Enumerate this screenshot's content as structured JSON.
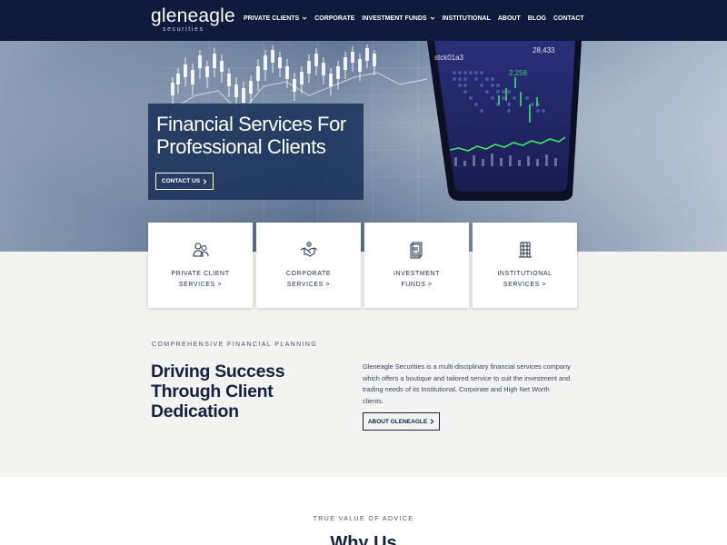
{
  "brand": {
    "name": "gleneagle",
    "tagline": "securities"
  },
  "nav": {
    "items": [
      {
        "label": "Private Clients",
        "dropdown": true
      },
      {
        "label": "Corporate",
        "dropdown": false
      },
      {
        "label": "Investment Funds",
        "dropdown": true
      },
      {
        "label": "Institutional",
        "dropdown": false
      },
      {
        "label": "About",
        "dropdown": false
      },
      {
        "label": "Blog",
        "dropdown": false
      },
      {
        "label": "Contact",
        "dropdown": false
      }
    ]
  },
  "hero": {
    "title": "Financial Services For Professional Clients",
    "button_label": "Contact Us",
    "phone_text": {
      "ticker": "stck01a3",
      "value": "28,433",
      "change": "2,256"
    }
  },
  "cards": [
    {
      "line1": "Private Client",
      "line2": "Services >",
      "icon": "people-icon"
    },
    {
      "line1": "Corporate",
      "line2": "Services >",
      "icon": "handshake-icon"
    },
    {
      "line1": "Investment",
      "line2": "Funds >",
      "icon": "document-chart-icon"
    },
    {
      "line1": "Institutional",
      "line2": "Services >",
      "icon": "building-icon"
    }
  ],
  "intro": {
    "eyebrow": "Comprehensive Financial Planning",
    "heading": "Driving Success Through Client Dedication",
    "text": "Gleneagle Securities is a multi-disciplinary financial services company which offers a boutique and tailored service to suit the investment and trading needs of its Institutional, Corporate and High Net Worth clients.",
    "button_label": "About Gleneagle"
  },
  "why": {
    "eyebrow": "True Value of Advice",
    "heading": "Why Us"
  },
  "colors": {
    "nav_bg": "#0f1a3c",
    "hero_box": "#173058",
    "accent_green": "#3be86a",
    "section_grey": "#f3f3f1"
  }
}
